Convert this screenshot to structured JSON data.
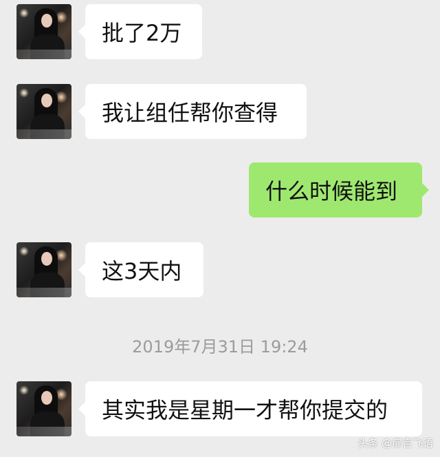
{
  "messages": [
    {
      "side": "in",
      "text": "批了2万"
    },
    {
      "side": "in",
      "text": "我让组任帮你查得"
    },
    {
      "side": "out",
      "text": "什么时候能到"
    },
    {
      "side": "in",
      "text": "这3天内"
    },
    {
      "side": "in",
      "text": "其实我是星期一才帮你提交的"
    }
  ],
  "timestamp": "2019年7月31日 19:24",
  "watermark": "头条 @扉言飞语",
  "colors": {
    "background": "#ececec",
    "incoming_bubble": "#ffffff",
    "outgoing_bubble": "#9fe870",
    "timestamp_text": "#9b9b9b"
  },
  "icons": {
    "contact_avatar": "contact-avatar-photo"
  }
}
